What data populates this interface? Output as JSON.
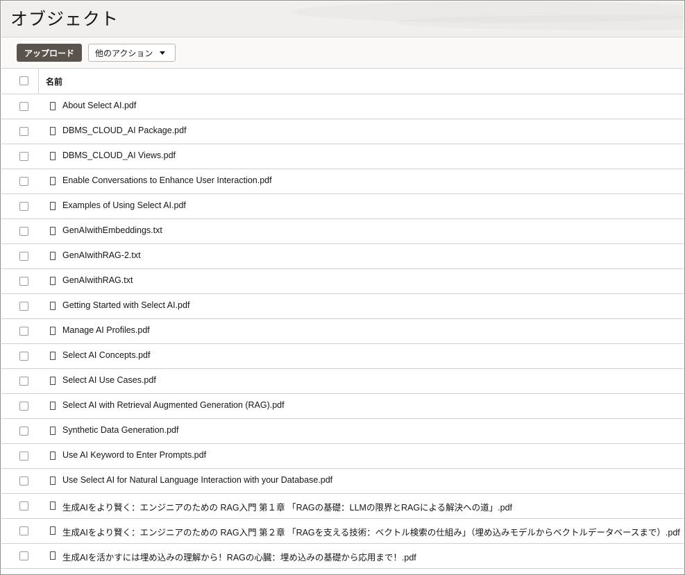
{
  "page": {
    "title": "オブジェクト"
  },
  "toolbar": {
    "upload_label": "アップロード",
    "more_actions_label": "他のアクション"
  },
  "table": {
    "column_name": "名前",
    "rows": [
      "About Select AI.pdf",
      "DBMS_CLOUD_AI Package.pdf",
      "DBMS_CLOUD_AI Views.pdf",
      "Enable Conversations to Enhance User Interaction.pdf",
      "Examples of Using Select AI.pdf",
      "GenAIwithEmbeddings.txt",
      "GenAIwithRAG-2.txt",
      "GenAIwithRAG.txt",
      "Getting Started with Select AI.pdf",
      "Manage AI Profiles.pdf",
      "Select AI Concepts.pdf",
      "Select AI Use Cases.pdf",
      "Select AI with Retrieval Augmented Generation (RAG).pdf",
      "Synthetic Data Generation.pdf",
      "Use AI Keyword to Enter Prompts.pdf",
      "Use Select AI for Natural Language Interaction with your Database.pdf",
      "生成AIをより賢く：エンジニアのための RAG入門 第１章 「RAGの基礎：LLMの限界とRAGによる解決への道」.pdf",
      "生成AIをより賢く：エンジニアのための RAG入門 第２章 「RAGを支える技術：ベクトル検索の仕組み」（埋め込みモデルからベクトルデータベースまで）.pdf",
      "生成AIを活かすには埋め込みの理解から！RAGの心臓：埋め込みの基礎から応用まで！.pdf"
    ]
  }
}
